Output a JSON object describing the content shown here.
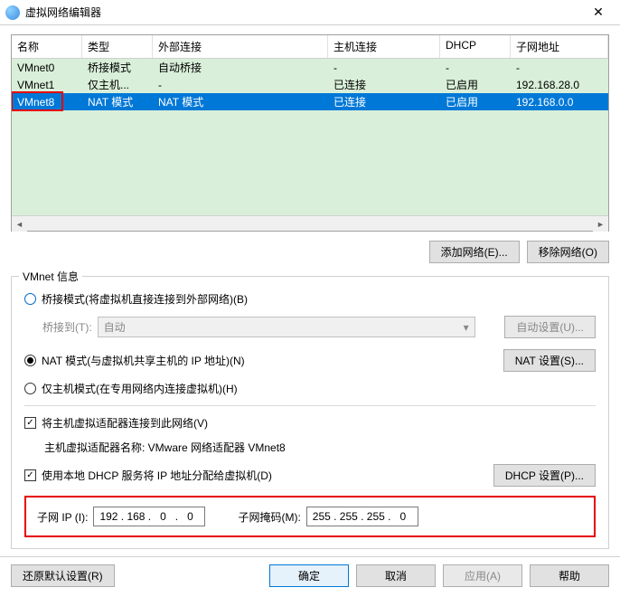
{
  "window": {
    "title": "虚拟网络编辑器",
    "close_glyph": "✕"
  },
  "table": {
    "headers": {
      "name": "名称",
      "type": "类型",
      "external": "外部连接",
      "host": "主机连接",
      "dhcp": "DHCP",
      "subnet": "子网地址"
    },
    "rows": [
      {
        "name": "VMnet0",
        "type": "桥接模式",
        "external": "自动桥接",
        "host": "-",
        "dhcp": "-",
        "subnet": "-"
      },
      {
        "name": "VMnet1",
        "type": "仅主机...",
        "external": "-",
        "host": "已连接",
        "dhcp": "已启用",
        "subnet": "192.168.28.0"
      },
      {
        "name": "VMnet8",
        "type": "NAT 模式",
        "external": "NAT 模式",
        "host": "已连接",
        "dhcp": "已启用",
        "subnet": "192.168.0.0"
      }
    ]
  },
  "buttons": {
    "add_network": "添加网络(E)...",
    "remove_network": "移除网络(O)",
    "auto_set": "自动设置(U)...",
    "nat_set": "NAT 设置(S)...",
    "dhcp_set": "DHCP 设置(P)...",
    "restore": "还原默认设置(R)",
    "ok": "确定",
    "cancel": "取消",
    "apply": "应用(A)",
    "help": "帮助"
  },
  "group": {
    "label": "VMnet 信息",
    "bridge_radio": "桥接模式(将虚拟机直接连接到外部网络)(B)",
    "bridge_to_label": "桥接到(T):",
    "bridge_to_value": "自动",
    "nat_radio": "NAT 模式(与虚拟机共享主机的 IP 地址)(N)",
    "hostonly_radio": "仅主机模式(在专用网络内连接虚拟机)(H)",
    "connect_host_check": "将主机虚拟适配器连接到此网络(V)",
    "adapter_name": "主机虚拟适配器名称: VMware 网络适配器 VMnet8",
    "dhcp_check": "使用本地 DHCP 服务将 IP 地址分配给虚拟机(D)"
  },
  "subnet": {
    "ip_label": "子网 IP (I):",
    "ip_parts": [
      "192",
      "168",
      "0",
      "0"
    ],
    "mask_label": "子网掩码(M):",
    "mask_parts": [
      "255",
      "255",
      "255",
      "0"
    ]
  }
}
